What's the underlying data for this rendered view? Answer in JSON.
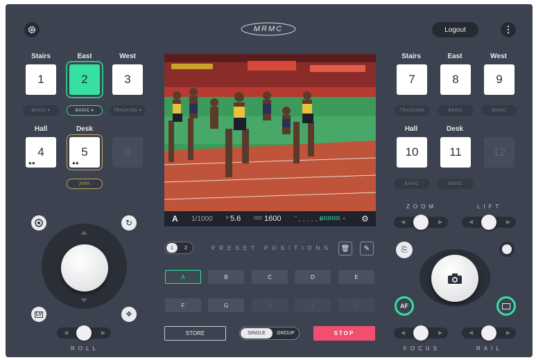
{
  "header": {
    "logo_text": "MRMC",
    "logout_label": "Logout",
    "settings_icon": "gear-icon",
    "menu_icon": "kebab-icon"
  },
  "left_cameras": {
    "row1": [
      {
        "label": "Stairs",
        "number": "1",
        "mode": "BASIC ▾",
        "state": "normal"
      },
      {
        "label": "East",
        "number": "2",
        "mode": "BASIC ▾",
        "state": "selected"
      },
      {
        "label": "West",
        "number": "3",
        "mode": "TRACKING ▾",
        "state": "normal"
      }
    ],
    "row2": [
      {
        "label": "Hall",
        "number": "4",
        "mode": "",
        "state": "normal"
      },
      {
        "label": "Desk",
        "number": "5",
        "mode": "john",
        "state": "user"
      },
      {
        "label": "",
        "number": "6",
        "mode": "",
        "state": "disabled"
      }
    ]
  },
  "right_cameras": {
    "row1": [
      {
        "label": "Stairs",
        "number": "7",
        "mode": "TRACKING"
      },
      {
        "label": "East",
        "number": "8",
        "mode": "BASIC"
      },
      {
        "label": "West",
        "number": "9",
        "mode": "BASIC"
      }
    ],
    "row2": [
      {
        "label": "Hall",
        "number": "10",
        "mode": "BASIC"
      },
      {
        "label": "Desk",
        "number": "11",
        "mode": "BASIC"
      },
      {
        "label": "",
        "number": "12",
        "mode": ""
      }
    ]
  },
  "camera_status": {
    "channel": "A",
    "shutter": "1/1000",
    "aperture_prefix": "F",
    "aperture": "5.6",
    "iso_prefix": "ISO",
    "iso": "1600",
    "exposure_minus": "−",
    "exposure_zero": "0",
    "exposure_plus": "+"
  },
  "presets": {
    "page_1": "1",
    "page_2": "2",
    "title": "PRESET POSITIONS",
    "buttons": [
      {
        "label": "A",
        "state": "selected"
      },
      {
        "label": "B",
        "state": "normal"
      },
      {
        "label": "C",
        "state": "normal"
      },
      {
        "label": "D",
        "state": "normal"
      },
      {
        "label": "E",
        "state": "normal"
      },
      {
        "label": "F",
        "state": "normal"
      },
      {
        "label": "G",
        "state": "normal"
      },
      {
        "label": "H",
        "state": "disabled"
      },
      {
        "label": "I",
        "state": "disabled"
      },
      {
        "label": "J",
        "state": "disabled"
      }
    ],
    "store_label": "STORE",
    "single_label": "SINGLE",
    "group_label": "GROUP",
    "stop_label": "STOP"
  },
  "controls": {
    "roll_label": "ROLL",
    "zoom_label": "ZOOM",
    "lift_label": "LIFT",
    "focus_label": "FOCUS",
    "rail_label": "RAIL",
    "af_label": "AF",
    "lv_label": "LV"
  },
  "colors": {
    "background": "#3c4250",
    "accent": "#35e0a0",
    "stop": "#f0506e",
    "user_badge": "#c9a95a"
  }
}
